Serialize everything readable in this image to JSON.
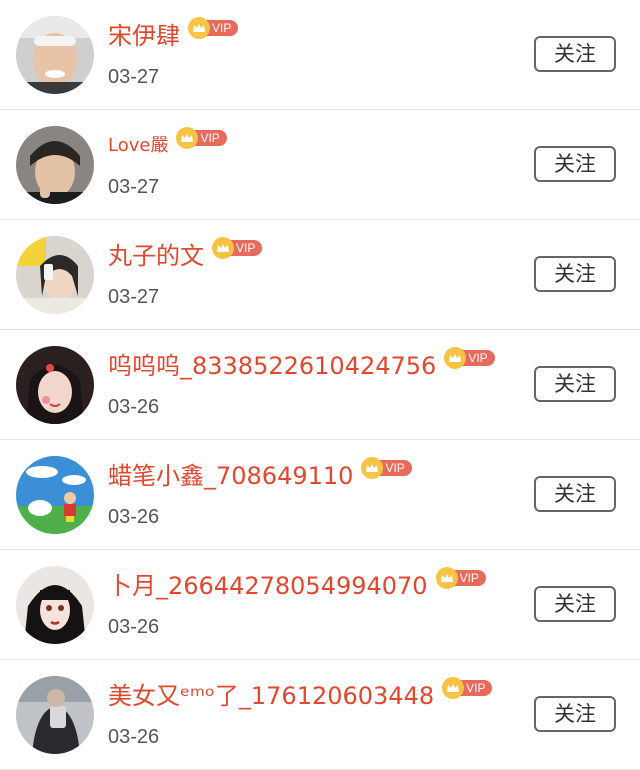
{
  "vip_label": "VIP",
  "follow_label": "关注",
  "colors": {
    "name_red": "#e2472f",
    "vip_badge": "#e86a5a",
    "crown_gold": "#f6c343",
    "date_gray": "#555555",
    "divider": "#e6e6e6"
  },
  "users": [
    {
      "name": "宋伊肆",
      "date": "03-27"
    },
    {
      "name": "Love嚴",
      "date": "03-27"
    },
    {
      "name": "丸子的文",
      "date": "03-27"
    },
    {
      "name": "呜呜呜_8338522610424756",
      "date": "03-26"
    },
    {
      "name": "蜡笔小鑫_708649110",
      "date": "03-26"
    },
    {
      "name": "卜月_26644278054994070",
      "date": "03-26"
    },
    {
      "name": "美女又ᵉᵐᵒ了_176120603448",
      "date": "03-26"
    }
  ]
}
